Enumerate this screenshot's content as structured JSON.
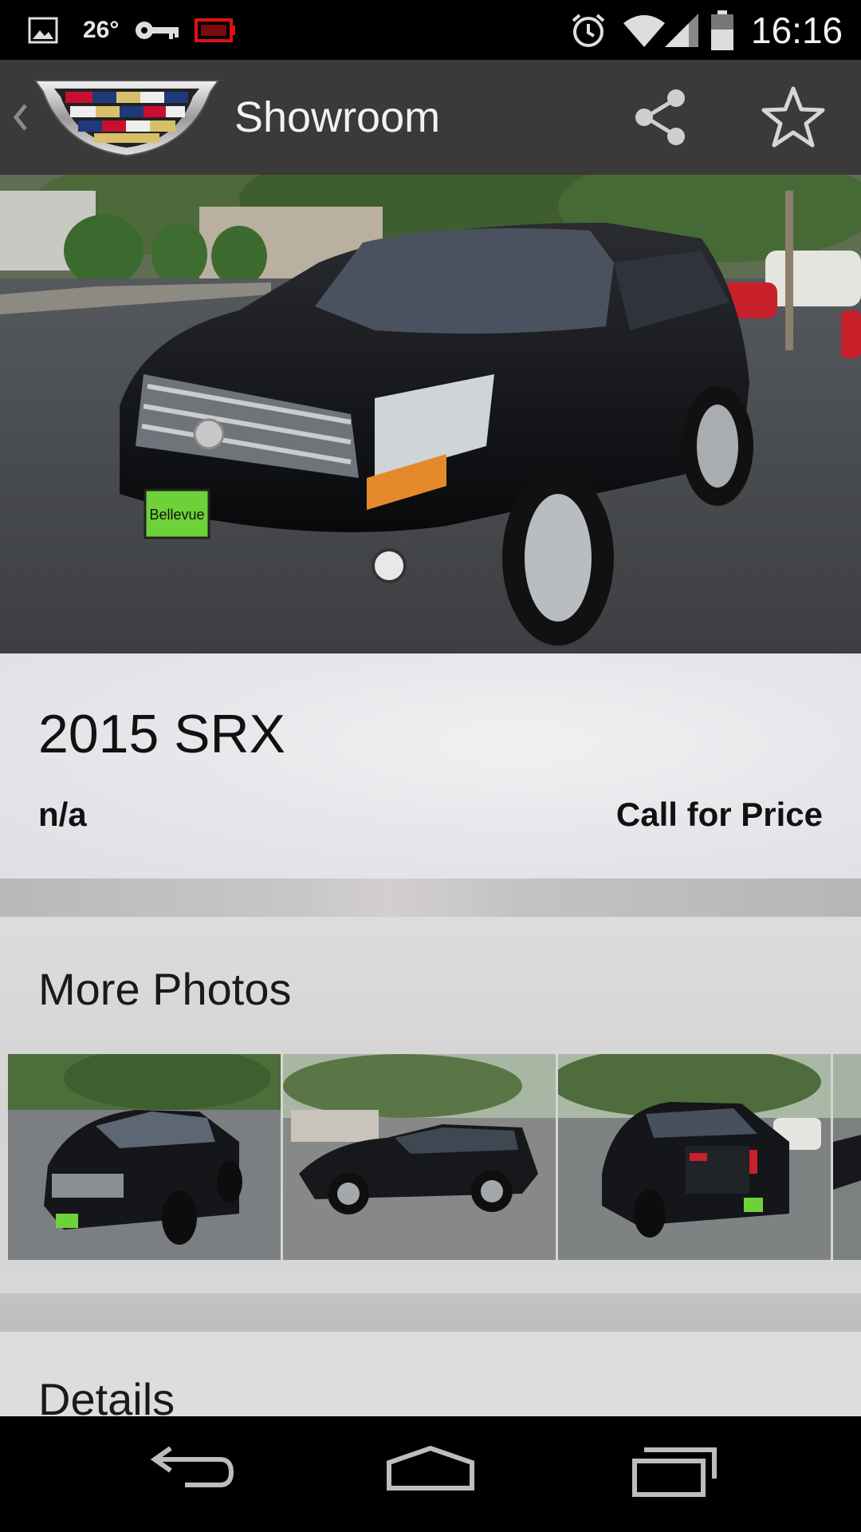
{
  "status_bar": {
    "temperature": "26°",
    "time": "16:16",
    "icons": [
      "image-notification-icon",
      "key-icon",
      "battery-warning-icon",
      "alarm-icon",
      "wifi-icon",
      "signal-icon",
      "battery-icon"
    ]
  },
  "action_bar": {
    "title": "Showroom",
    "icons": [
      "back-chevron-icon",
      "cadillac-logo",
      "share-icon",
      "star-icon"
    ]
  },
  "vehicle": {
    "title": "2015 SRX",
    "subtitle": "n/a",
    "price": "Call for Price",
    "plate_text": "Bellevue"
  },
  "more_photos": {
    "title": "More Photos",
    "count_visible": 4
  },
  "details": {
    "title": "Details"
  },
  "nav_bar": {
    "icons": [
      "back-icon",
      "home-icon",
      "recents-icon"
    ]
  },
  "colors": {
    "status_bar": "#000000",
    "action_bar": "#3a3a3a",
    "card_bg": "#e3e4e6",
    "text": "#111111"
  }
}
